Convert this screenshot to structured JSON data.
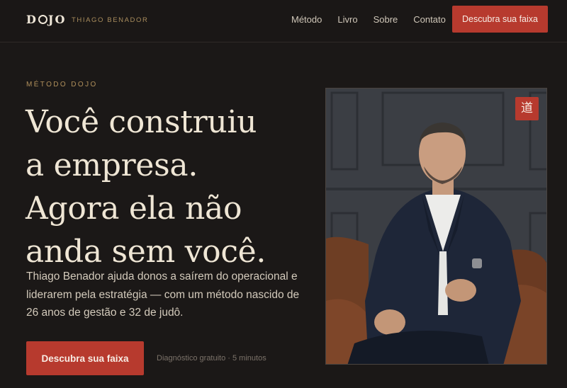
{
  "nav": {
    "logo_left": "D",
    "logo_right": "JO",
    "logo_subtitle": "THIAGO BENADOR",
    "links": [
      "Método",
      "Livro",
      "Sobre",
      "Contato"
    ],
    "cta": "Descubra sua faixa"
  },
  "hero": {
    "eyebrow": "MÉTODO DOJO",
    "headline": [
      "Você construiu",
      "a empresa.",
      "Agora ela não",
      "anda sem você."
    ],
    "lead": "Thiago Benador ajuda donos a saírem do operacional e liderarem pela estratégia — com um método nascido de 26 anos de gestão e 32 de judô.",
    "cta": "Descubra sua faixa",
    "cta_note": "Diagnóstico gratuito · 5 minutos"
  },
  "portrait": {
    "badge": "道"
  },
  "colors": {
    "background": "#1b1817",
    "accent": "#b73a2e",
    "gold": "#b08f5b",
    "cream": "#efe6d5"
  }
}
